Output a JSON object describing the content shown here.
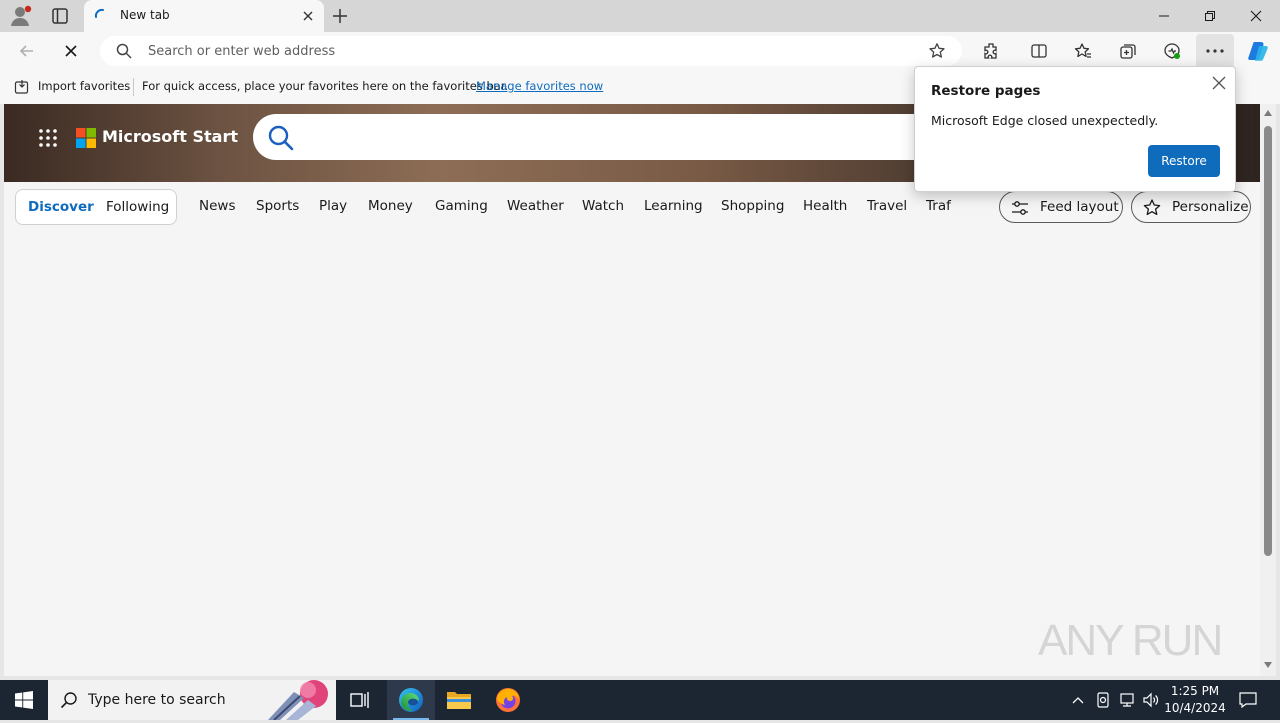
{
  "browser": {
    "tab": {
      "title": "New tab"
    },
    "address_bar": {
      "placeholder": "Search or enter web address",
      "value": ""
    },
    "favorites_bar": {
      "import_label": "Import favorites",
      "hint": "For quick access, place your favorites here on the favorites bar.",
      "manage_link": "Manage favorites now"
    }
  },
  "page": {
    "brand": "Microsoft Start",
    "feed_tabs": {
      "discover": "Discover",
      "following": "Following"
    },
    "categories": [
      "News",
      "Sports",
      "Play",
      "Money",
      "Gaming",
      "Weather",
      "Watch",
      "Learning",
      "Shopping",
      "Health",
      "Travel",
      "Traf"
    ],
    "feed_layout_label": "Feed layout",
    "personalize_label": "Personalize"
  },
  "restore_popup": {
    "title": "Restore pages",
    "message": "Microsoft Edge closed unexpectedly.",
    "button": "Restore"
  },
  "watermark": "ANY RUN",
  "taskbar": {
    "search_placeholder": "Type here to search",
    "time": "1:25 PM",
    "date": "10/4/2024"
  },
  "colors": {
    "accent": "#0f6cbd",
    "taskbar": "#1c2532"
  }
}
